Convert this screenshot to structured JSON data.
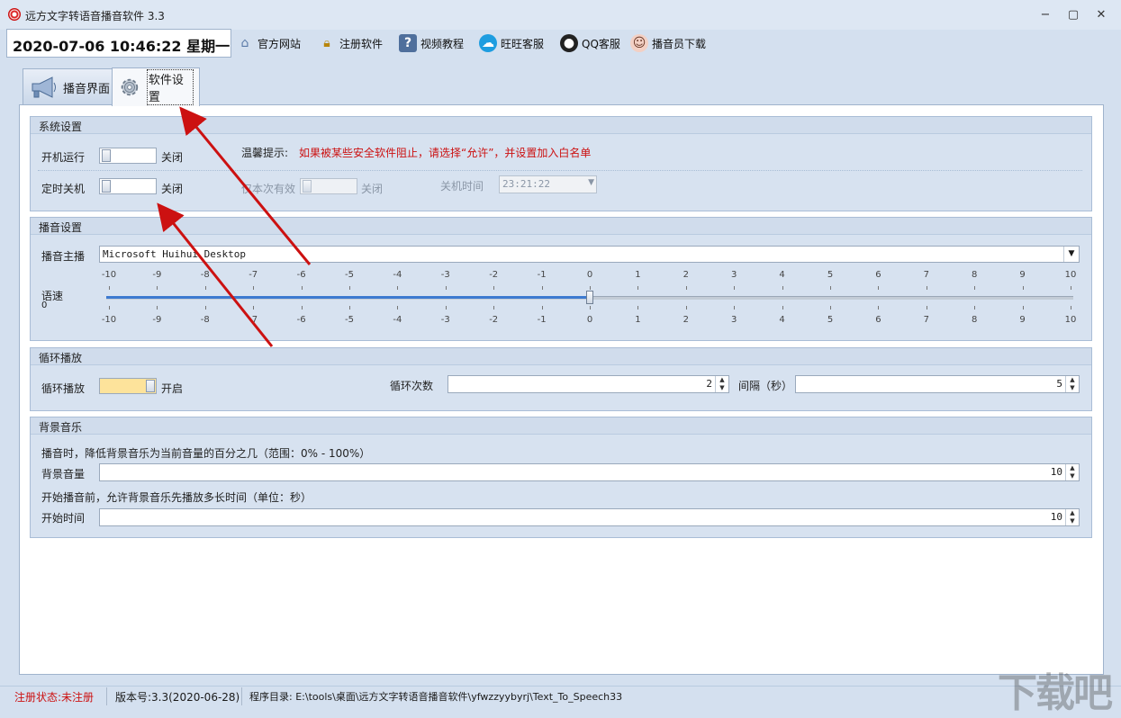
{
  "window": {
    "title": "远方文字转语音播音软件 3.3",
    "minimize": "−",
    "maximize": "▢",
    "close": "✕"
  },
  "toolbar": {
    "datetime": "2020-07-06 10:46:22 星期一",
    "items": [
      {
        "label": "官方网站",
        "icon": "home-icon"
      },
      {
        "label": "注册软件",
        "icon": "lock-icon"
      },
      {
        "label": "视频教程",
        "icon": "help-book-icon"
      },
      {
        "label": "旺旺客服",
        "icon": "wangwang-icon"
      },
      {
        "label": "QQ客服",
        "icon": "qq-penguin-icon"
      },
      {
        "label": "播音员下载",
        "icon": "person-icon"
      }
    ]
  },
  "tabs": [
    {
      "label": "播音界面",
      "icon": "megaphone-icon"
    },
    {
      "label": "软件设置",
      "icon": "gear-icon"
    }
  ],
  "system": {
    "title": "系统设置",
    "autostart_label": "开机运行",
    "autostart_state": "关闭",
    "tip_label": "温馨提示:",
    "tip_text": "如果被某些安全软件阻止，请选择“允许”，并设置加入白名单",
    "shutdown_label": "定时关机",
    "shutdown_state": "关闭",
    "once_label": "仅本次有效",
    "once_state": "关闭",
    "shutdown_time_label": "关机时间",
    "shutdown_time": "23:21:22"
  },
  "broadcast": {
    "title": "播音设置",
    "anchor_label": "播音主播",
    "anchor_value": "Microsoft Huihui Desktop",
    "speed_label": "语速",
    "speed_value": "0",
    "ticks": [
      "-10",
      "-9",
      "-8",
      "-7",
      "-6",
      "-5",
      "-4",
      "-3",
      "-2",
      "-1",
      "0",
      "1",
      "2",
      "3",
      "4",
      "5",
      "6",
      "7",
      "8",
      "9",
      "10"
    ],
    "slider_value": 0,
    "slider_min": -10,
    "slider_max": 10
  },
  "loop": {
    "title": "循环播放",
    "loop_label": "循环播放",
    "loop_state": "开启",
    "count_label": "循环次数",
    "count_value": "2",
    "interval_label": "间隔（秒）",
    "interval_value": "5"
  },
  "bgm": {
    "title": "背景音乐",
    "desc1": "播音时，降低背景音乐为当前音量的百分之几（范围：0% - 100%）",
    "volume_label": "背景音量",
    "volume_value": "10",
    "desc2": "开始播音前，允许背景音乐先播放多长时间（单位：秒）",
    "start_label": "开始时间",
    "start_value": "10"
  },
  "status": {
    "reg": "注册状态:未注册",
    "version": "版本号:3.3(2020-06-28)",
    "dir": "程序目录: E:\\tools\\桌面\\远方文字转语音播音软件\\yfwzzyybyrj\\Text_To_Speech33"
  },
  "watermark": "下载吧",
  "colors": {
    "accent_red": "#cc1111",
    "toggle_on": "#fde39b",
    "bg": "#d4e0ef"
  }
}
